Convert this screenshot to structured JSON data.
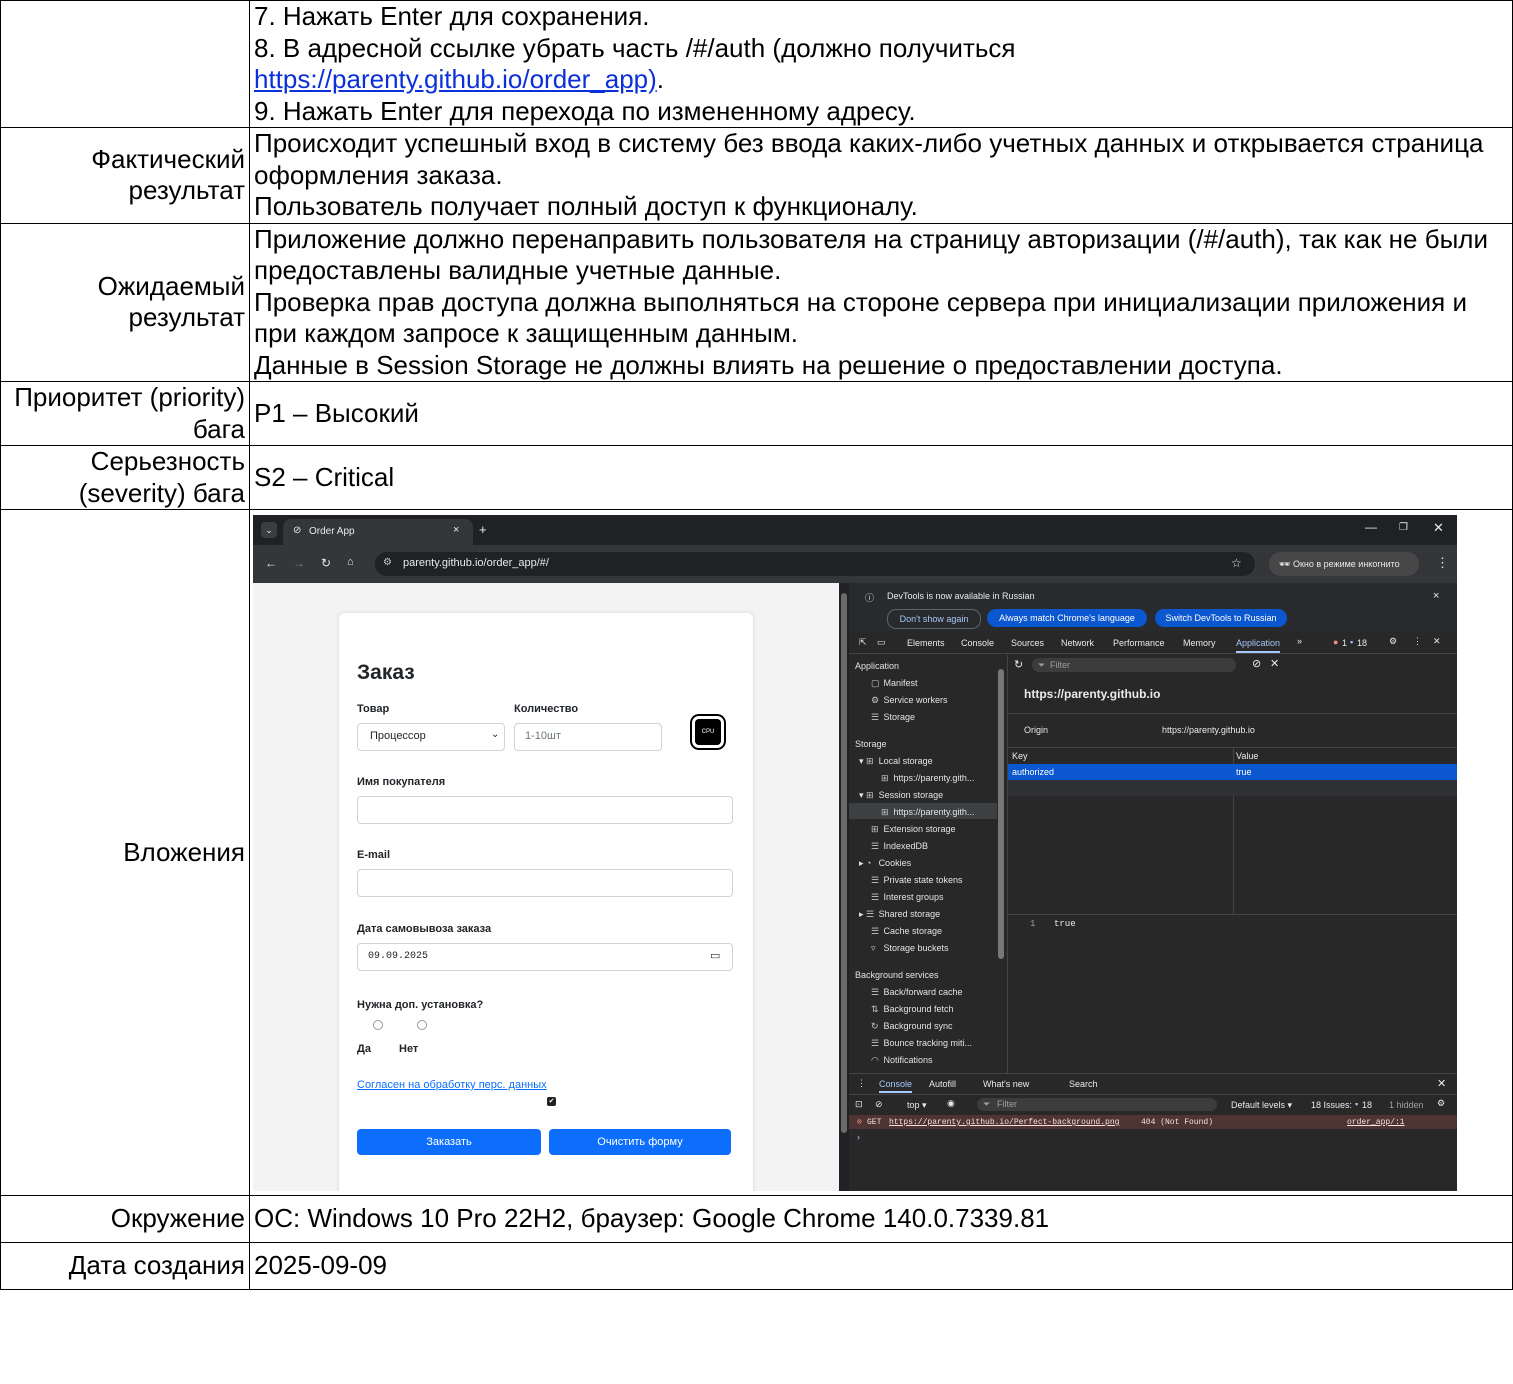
{
  "steps": {
    "s7": "7. Нажать Enter для сохранения.",
    "s8a": "8. В адресной ссылке убрать часть /#/auth (должно получиться",
    "s8_link": "https://parenty.github.io/order_app)",
    "s8_end": ".",
    "s9": "9. Нажать Enter для перехода по измененному адресу."
  },
  "actual": {
    "label": "Фактический результат",
    "lines": [
      "Происходит успешный вход в систему без ввода каких-либо учетных данных и открывается страница оформления заказа.",
      "Пользователь получает полный доступ к функционалу."
    ]
  },
  "expected": {
    "label": "Ожидаемый результат",
    "lines": [
      "Приложение должно перенаправить пользователя на страницу авторизации (/#/auth), так как не были предоставлены валидные учетные данные.",
      "Проверка прав доступа должна выполняться на стороне сервера при инициализации приложения и при каждом запросе к защищенным данным.",
      "Данные в Session Storage не должны влиять на решение о предоставлении доступа."
    ]
  },
  "priority": {
    "label": "Приоритет (priority) бага",
    "value": "P1 – Высокий"
  },
  "severity": {
    "label": "Серьезность (severity) бага",
    "value": "S2 – Critical"
  },
  "attachments": {
    "label": "Вложения"
  },
  "environment": {
    "label": "Окружение",
    "value": "ОС: Windows 10 Pro 22H2, браузер: Google Chrome 140.0.7339.81"
  },
  "created": {
    "label": "Дата создания",
    "value": "2025-09-09"
  },
  "screenshot": {
    "tab_title": "Order App",
    "url": "parenty.github.io/order_app/#/",
    "incognito": "Окно в режиме инкогнито",
    "form": {
      "title": "Заказ",
      "product_label": "Товар",
      "product_value": "Процессор",
      "qty_label": "Количество",
      "qty_placeholder": "1-10шт",
      "cpu": "CPU",
      "name_label": "Имя покупателя",
      "email_label": "E-mail",
      "date_label": "Дата самовывоза заказа",
      "date_value": "09.09.2025",
      "install_label": "Нужна доп. установка?",
      "yes": "Да",
      "no": "Нет",
      "consent": "Согласен на обработку перс. данных",
      "order_btn": "Заказать",
      "clear_btn": "Очистить форму"
    },
    "devtools": {
      "notice": "DevTools is now available in Russian",
      "btn_dont": "Don't show again",
      "btn_match": "Always match Chrome's language",
      "btn_switch": "Switch DevTools to Russian",
      "tabs": [
        "Elements",
        "Console",
        "Sources",
        "Network",
        "Performance",
        "Memory",
        "Application"
      ],
      "err_count": "1",
      "msg_count": "18",
      "tree": {
        "app_header": "Application",
        "manifest": "Manifest",
        "service_workers": "Service workers",
        "storage_item": "Storage",
        "storage_header": "Storage",
        "local": "Local storage",
        "local_child": "https://parenty.gith...",
        "session": "Session storage",
        "session_child": "https://parenty.gith...",
        "extension": "Extension storage",
        "indexeddb": "IndexedDB",
        "cookies": "Cookies",
        "private_tokens": "Private state tokens",
        "interest": "Interest groups",
        "shared": "Shared storage",
        "cache": "Cache storage",
        "buckets": "Storage buckets",
        "bg_header": "Background services",
        "bfcache": "Back/forward cache",
        "bgfetch": "Background fetch",
        "bgsync": "Background sync",
        "bounce": "Bounce tracking miti...",
        "notifications": "Notifications"
      },
      "filter_placeholder": "Filter",
      "origin_title": "https://parenty.github.io",
      "origin_label": "Origin",
      "origin_value": "https://parenty.github.io",
      "col_key": "Key",
      "col_value": "Value",
      "row_key": "authorized",
      "row_value": "true",
      "preview_line": "1",
      "preview_value": "true",
      "drawer_tabs": [
        "Console",
        "Autofill",
        "What's new",
        "Search"
      ],
      "context": "top",
      "console_filter": "Filter",
      "levels": "Default levels",
      "issues": "18 Issues:",
      "issues_count": "18",
      "hidden": "1 hidden",
      "err_method": "GET",
      "err_url": "https://parenty.github.io/Perfect-background.png",
      "err_status": "404 (Not Found)",
      "err_source": "order_app/:1"
    }
  }
}
